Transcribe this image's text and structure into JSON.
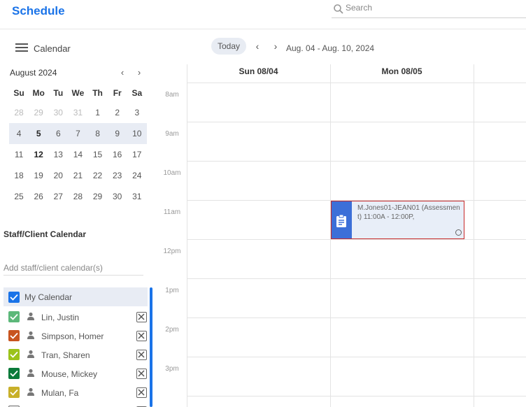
{
  "app_title": "Schedule",
  "search": {
    "placeholder": "Search"
  },
  "calendar_header": {
    "menu_label": "Calendar",
    "today_label": "Today",
    "date_range": "Aug. 04 - Aug. 10, 2024"
  },
  "mini_calendar": {
    "month_label": "August 2024",
    "weekdays": [
      "Su",
      "Mo",
      "Tu",
      "We",
      "Th",
      "Fr",
      "Sa"
    ],
    "weeks": [
      [
        "28",
        "29",
        "30",
        "31",
        "1",
        "2",
        "3"
      ],
      [
        "4",
        "5",
        "6",
        "7",
        "8",
        "9",
        "10"
      ],
      [
        "11",
        "12",
        "13",
        "14",
        "15",
        "16",
        "17"
      ],
      [
        "18",
        "19",
        "20",
        "21",
        "22",
        "23",
        "24"
      ],
      [
        "25",
        "26",
        "27",
        "28",
        "29",
        "30",
        "31"
      ]
    ],
    "selected_week": 1,
    "bold_days": [
      "5",
      "12"
    ]
  },
  "staff_section": {
    "title": "Staff/Client Calendar",
    "add_placeholder": "Add staff/client calendar(s)",
    "my_calendar_label": "My Calendar",
    "my_calendar_color": "#1a73e8",
    "calendars": [
      {
        "name": "Lin, Justin",
        "color": "#5cb87a"
      },
      {
        "name": "Simpson, Homer",
        "color": "#c8541f"
      },
      {
        "name": "Tran, Sharen",
        "color": "#9bc31a"
      },
      {
        "name": "Mouse, Mickey",
        "color": "#0b7a3a"
      },
      {
        "name": "Mulan, Fa",
        "color": "#c8b02a"
      },
      {
        "name": "",
        "color": "#ffffff"
      }
    ]
  },
  "week_view": {
    "days": [
      "Sun 08/04",
      "Mon 08/05",
      ""
    ],
    "hours": [
      "8am",
      "9am",
      "10am",
      "11am",
      "12pm",
      "1pm",
      "2pm",
      "3pm",
      ""
    ]
  },
  "event": {
    "title": "M.Jones01-JEAN01 (Assessment) 11:00A - 12:00P,",
    "strip_color": "#3c6fd8",
    "border_color": "#c62828"
  }
}
